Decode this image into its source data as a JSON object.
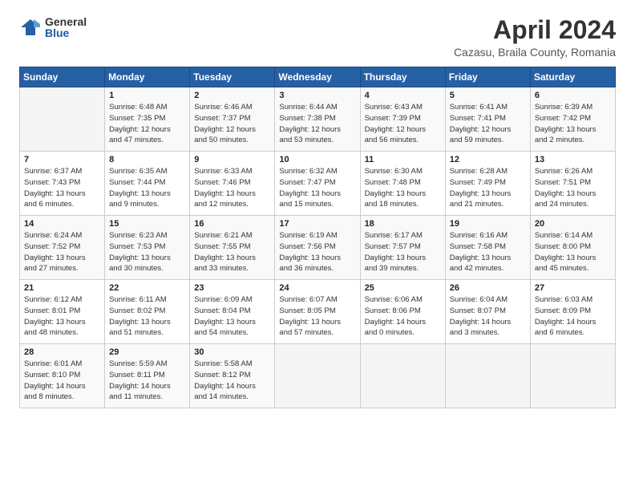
{
  "logo": {
    "general": "General",
    "blue": "Blue"
  },
  "title": "April 2024",
  "location": "Cazasu, Braila County, Romania",
  "headers": [
    "Sunday",
    "Monday",
    "Tuesday",
    "Wednesday",
    "Thursday",
    "Friday",
    "Saturday"
  ],
  "weeks": [
    [
      {
        "day": "",
        "info": ""
      },
      {
        "day": "1",
        "info": "Sunrise: 6:48 AM\nSunset: 7:35 PM\nDaylight: 12 hours\nand 47 minutes."
      },
      {
        "day": "2",
        "info": "Sunrise: 6:46 AM\nSunset: 7:37 PM\nDaylight: 12 hours\nand 50 minutes."
      },
      {
        "day": "3",
        "info": "Sunrise: 6:44 AM\nSunset: 7:38 PM\nDaylight: 12 hours\nand 53 minutes."
      },
      {
        "day": "4",
        "info": "Sunrise: 6:43 AM\nSunset: 7:39 PM\nDaylight: 12 hours\nand 56 minutes."
      },
      {
        "day": "5",
        "info": "Sunrise: 6:41 AM\nSunset: 7:41 PM\nDaylight: 12 hours\nand 59 minutes."
      },
      {
        "day": "6",
        "info": "Sunrise: 6:39 AM\nSunset: 7:42 PM\nDaylight: 13 hours\nand 2 minutes."
      }
    ],
    [
      {
        "day": "7",
        "info": "Sunrise: 6:37 AM\nSunset: 7:43 PM\nDaylight: 13 hours\nand 6 minutes."
      },
      {
        "day": "8",
        "info": "Sunrise: 6:35 AM\nSunset: 7:44 PM\nDaylight: 13 hours\nand 9 minutes."
      },
      {
        "day": "9",
        "info": "Sunrise: 6:33 AM\nSunset: 7:46 PM\nDaylight: 13 hours\nand 12 minutes."
      },
      {
        "day": "10",
        "info": "Sunrise: 6:32 AM\nSunset: 7:47 PM\nDaylight: 13 hours\nand 15 minutes."
      },
      {
        "day": "11",
        "info": "Sunrise: 6:30 AM\nSunset: 7:48 PM\nDaylight: 13 hours\nand 18 minutes."
      },
      {
        "day": "12",
        "info": "Sunrise: 6:28 AM\nSunset: 7:49 PM\nDaylight: 13 hours\nand 21 minutes."
      },
      {
        "day": "13",
        "info": "Sunrise: 6:26 AM\nSunset: 7:51 PM\nDaylight: 13 hours\nand 24 minutes."
      }
    ],
    [
      {
        "day": "14",
        "info": "Sunrise: 6:24 AM\nSunset: 7:52 PM\nDaylight: 13 hours\nand 27 minutes."
      },
      {
        "day": "15",
        "info": "Sunrise: 6:23 AM\nSunset: 7:53 PM\nDaylight: 13 hours\nand 30 minutes."
      },
      {
        "day": "16",
        "info": "Sunrise: 6:21 AM\nSunset: 7:55 PM\nDaylight: 13 hours\nand 33 minutes."
      },
      {
        "day": "17",
        "info": "Sunrise: 6:19 AM\nSunset: 7:56 PM\nDaylight: 13 hours\nand 36 minutes."
      },
      {
        "day": "18",
        "info": "Sunrise: 6:17 AM\nSunset: 7:57 PM\nDaylight: 13 hours\nand 39 minutes."
      },
      {
        "day": "19",
        "info": "Sunrise: 6:16 AM\nSunset: 7:58 PM\nDaylight: 13 hours\nand 42 minutes."
      },
      {
        "day": "20",
        "info": "Sunrise: 6:14 AM\nSunset: 8:00 PM\nDaylight: 13 hours\nand 45 minutes."
      }
    ],
    [
      {
        "day": "21",
        "info": "Sunrise: 6:12 AM\nSunset: 8:01 PM\nDaylight: 13 hours\nand 48 minutes."
      },
      {
        "day": "22",
        "info": "Sunrise: 6:11 AM\nSunset: 8:02 PM\nDaylight: 13 hours\nand 51 minutes."
      },
      {
        "day": "23",
        "info": "Sunrise: 6:09 AM\nSunset: 8:04 PM\nDaylight: 13 hours\nand 54 minutes."
      },
      {
        "day": "24",
        "info": "Sunrise: 6:07 AM\nSunset: 8:05 PM\nDaylight: 13 hours\nand 57 minutes."
      },
      {
        "day": "25",
        "info": "Sunrise: 6:06 AM\nSunset: 8:06 PM\nDaylight: 14 hours\nand 0 minutes."
      },
      {
        "day": "26",
        "info": "Sunrise: 6:04 AM\nSunset: 8:07 PM\nDaylight: 14 hours\nand 3 minutes."
      },
      {
        "day": "27",
        "info": "Sunrise: 6:03 AM\nSunset: 8:09 PM\nDaylight: 14 hours\nand 6 minutes."
      }
    ],
    [
      {
        "day": "28",
        "info": "Sunrise: 6:01 AM\nSunset: 8:10 PM\nDaylight: 14 hours\nand 8 minutes."
      },
      {
        "day": "29",
        "info": "Sunrise: 5:59 AM\nSunset: 8:11 PM\nDaylight: 14 hours\nand 11 minutes."
      },
      {
        "day": "30",
        "info": "Sunrise: 5:58 AM\nSunset: 8:12 PM\nDaylight: 14 hours\nand 14 minutes."
      },
      {
        "day": "",
        "info": ""
      },
      {
        "day": "",
        "info": ""
      },
      {
        "day": "",
        "info": ""
      },
      {
        "day": "",
        "info": ""
      }
    ]
  ]
}
